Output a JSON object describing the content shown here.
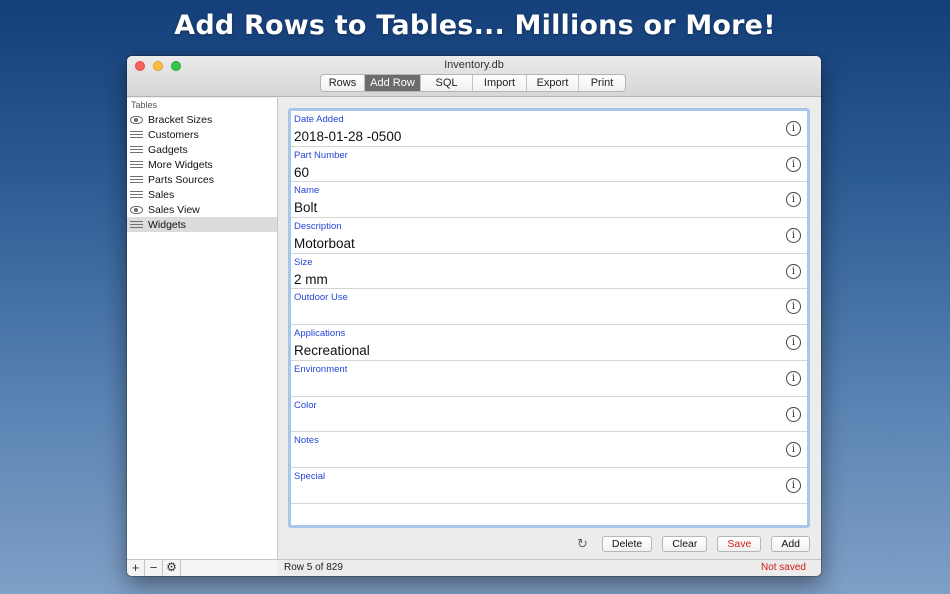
{
  "headline": "Add Rows to Tables... Millions or More!",
  "window": {
    "title": "Inventory.db"
  },
  "toolbar": {
    "tabs": [
      {
        "label": "Rows"
      },
      {
        "label": "Add Row"
      },
      {
        "label": "SQL"
      },
      {
        "label": "Import"
      },
      {
        "label": "Export"
      },
      {
        "label": "Print"
      }
    ],
    "active_tab": "Add Row"
  },
  "sidebar": {
    "header": "Tables",
    "items": [
      {
        "label": "Bracket Sizes",
        "icon": "eye-icon"
      },
      {
        "label": "Customers",
        "icon": "table-icon"
      },
      {
        "label": "Gadgets",
        "icon": "table-icon"
      },
      {
        "label": "More Widgets",
        "icon": "table-icon"
      },
      {
        "label": "Parts Sources",
        "icon": "table-icon"
      },
      {
        "label": "Sales",
        "icon": "table-icon"
      },
      {
        "label": "Sales View",
        "icon": "eye-icon"
      },
      {
        "label": "Widgets",
        "icon": "table-icon"
      }
    ],
    "selected": "Widgets",
    "footer": {
      "add": "+",
      "remove": "−",
      "gear": "⚙"
    }
  },
  "form": {
    "fields": [
      {
        "label": "Date Added",
        "value": "2018-01-28 -0500"
      },
      {
        "label": "Part Number",
        "value": "60"
      },
      {
        "label": "Name",
        "value": "Bolt"
      },
      {
        "label": "Description",
        "value": "Motorboat"
      },
      {
        "label": "Size",
        "value": "2 mm"
      },
      {
        "label": "Outdoor Use",
        "value": ""
      },
      {
        "label": "Applications",
        "value": "Recreational"
      },
      {
        "label": "Environment",
        "value": ""
      },
      {
        "label": "Color",
        "value": ""
      },
      {
        "label": "Notes",
        "value": ""
      },
      {
        "label": "Special",
        "value": ""
      }
    ],
    "info_glyph": "i"
  },
  "actions": {
    "refresh_glyph": "↻",
    "delete": "Delete",
    "clear": "Clear",
    "save": "Save",
    "add": "Add"
  },
  "status": {
    "row_info": "Row 5 of 829",
    "save_state": "Not saved"
  },
  "colors": {
    "label_blue": "#2346d6",
    "warning_red": "#d01d16",
    "focus_ring": "#a8c6ea"
  }
}
